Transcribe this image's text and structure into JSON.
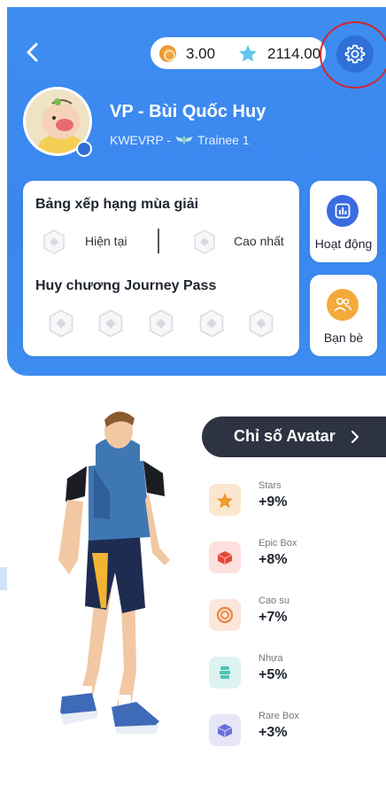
{
  "header": {
    "coins": "3.00",
    "stars": "2114.00"
  },
  "profile": {
    "name": "VP - Bùi Quốc Huy",
    "code": "KWEVRP -",
    "rank": "Trainee 1"
  },
  "season_ranking": {
    "title": "Bảng xếp hạng mùa giải",
    "current_label": "Hiện tại",
    "best_label": "Cao nhất"
  },
  "journey_pass": {
    "title": "Huy chương Journey Pass",
    "medal_count": 5
  },
  "side_buttons": {
    "activity_label": "Hoạt động",
    "friends_label": "Bạn bè"
  },
  "avatar_stats": {
    "button_label": "Chỉ số Avatar",
    "items": [
      {
        "name": "Stars",
        "value": "+9%",
        "icon": "star-icon",
        "bg": "#fbe7cf"
      },
      {
        "name": "Epic Box",
        "value": "+8%",
        "icon": "epic-box-icon",
        "bg": "#fbe0dd"
      },
      {
        "name": "Cao su",
        "value": "+7%",
        "icon": "rubber-icon",
        "bg": "#fbe6da"
      },
      {
        "name": "Nhựa",
        "value": "+5%",
        "icon": "plastic-icon",
        "bg": "#dcf3f0"
      },
      {
        "name": "Rare Box",
        "value": "+3%",
        "icon": "rare-box-icon",
        "bg": "#e6e6f7"
      }
    ]
  },
  "colors": {
    "header_blue": "#3d8bf0",
    "settings_blue": "#2f6fd6",
    "highlight_red": "#d22630",
    "activity_icon": "#3a6be0",
    "friends_icon": "#f4a93b",
    "stats_button": "#2d3340"
  }
}
